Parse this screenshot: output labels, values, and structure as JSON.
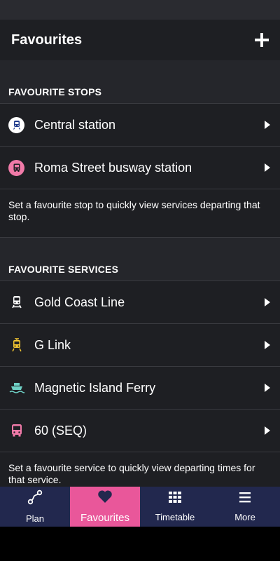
{
  "header": {
    "title": "Favourites"
  },
  "stops": {
    "heading": "FAVOURITE STOPS",
    "items": [
      {
        "label": "Central station",
        "icon": "train-stop-icon",
        "color": "#ffffff"
      },
      {
        "label": "Roma Street busway station",
        "icon": "bus-stop-icon",
        "color": "#f07aa8"
      }
    ],
    "note": "Set a favourite stop to quickly view services departing that stop."
  },
  "services": {
    "heading": "FAVOURITE SERVICES",
    "items": [
      {
        "label": "Gold Coast Line",
        "icon": "train-icon",
        "color": "#ffffff"
      },
      {
        "label": "G Link",
        "icon": "tram-icon",
        "color": "#f2c531"
      },
      {
        "label": "Magnetic Island Ferry",
        "icon": "ferry-icon",
        "color": "#6fd1c6"
      },
      {
        "label": "60 (SEQ)",
        "icon": "bus-icon",
        "color": "#f07aa8"
      }
    ],
    "note": "Set a favourite service to quickly view departing times for that service."
  },
  "tabs": [
    {
      "label": "Plan",
      "icon": "route-icon"
    },
    {
      "label": "Favourites",
      "icon": "heart-icon",
      "active": true
    },
    {
      "label": "Timetable",
      "icon": "grid-icon"
    },
    {
      "label": "More",
      "icon": "menu-icon"
    }
  ],
  "colors": {
    "tabbar": "#22284e",
    "active_tab": "#e9579a",
    "background": "#25262b"
  }
}
